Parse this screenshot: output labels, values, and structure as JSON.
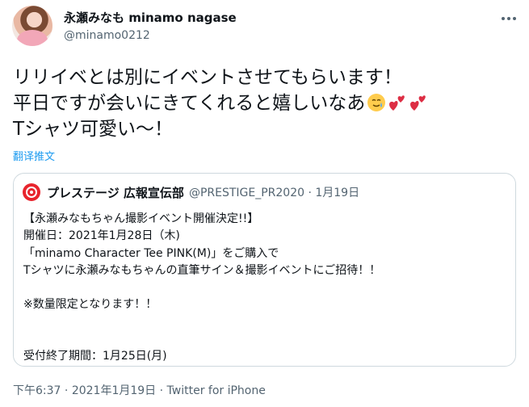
{
  "author": {
    "display_name": "永瀬みなも minamo nagase",
    "handle": "@minamo0212"
  },
  "tweet": {
    "lines": [
      "リリイベとは別にイベントさせてもらいます！",
      "平日ですが会いにきてくれると嬉しいなあ",
      "Tシャツ可愛い〜！"
    ],
    "emojis": [
      "tear-smile-emoji",
      "two-hearts-emoji",
      "two-hearts-emoji"
    ]
  },
  "translate_label": "翻译推文",
  "quote": {
    "name": "プレステージ 広報宣伝部",
    "handle_date": "@PRESTIGE_PR2020 · 1月19日",
    "lines": [
      "【永瀬みなもちゃん撮影イベント開催決定!!】",
      "開催日：2021年1月28日（木)",
      "「minamo Character Tee PINK(M)」をご購入で",
      "Tシャツに永瀬みなもちゃんの直筆サイン＆撮影イベントにご招待！！",
      "",
      "※数量限定となります！！",
      "",
      "",
      "受付終了期間：1月25日(月)"
    ]
  },
  "timestamp": {
    "time": "下午6:37",
    "sep1": " · ",
    "date": "2021年1月19日",
    "sep2": " · ",
    "source": "Twitter for iPhone"
  },
  "colors": {
    "link": "#1d9bf0",
    "secondary_text": "#536471",
    "border": "#cfd9de",
    "brand_red": "#e8242d"
  }
}
